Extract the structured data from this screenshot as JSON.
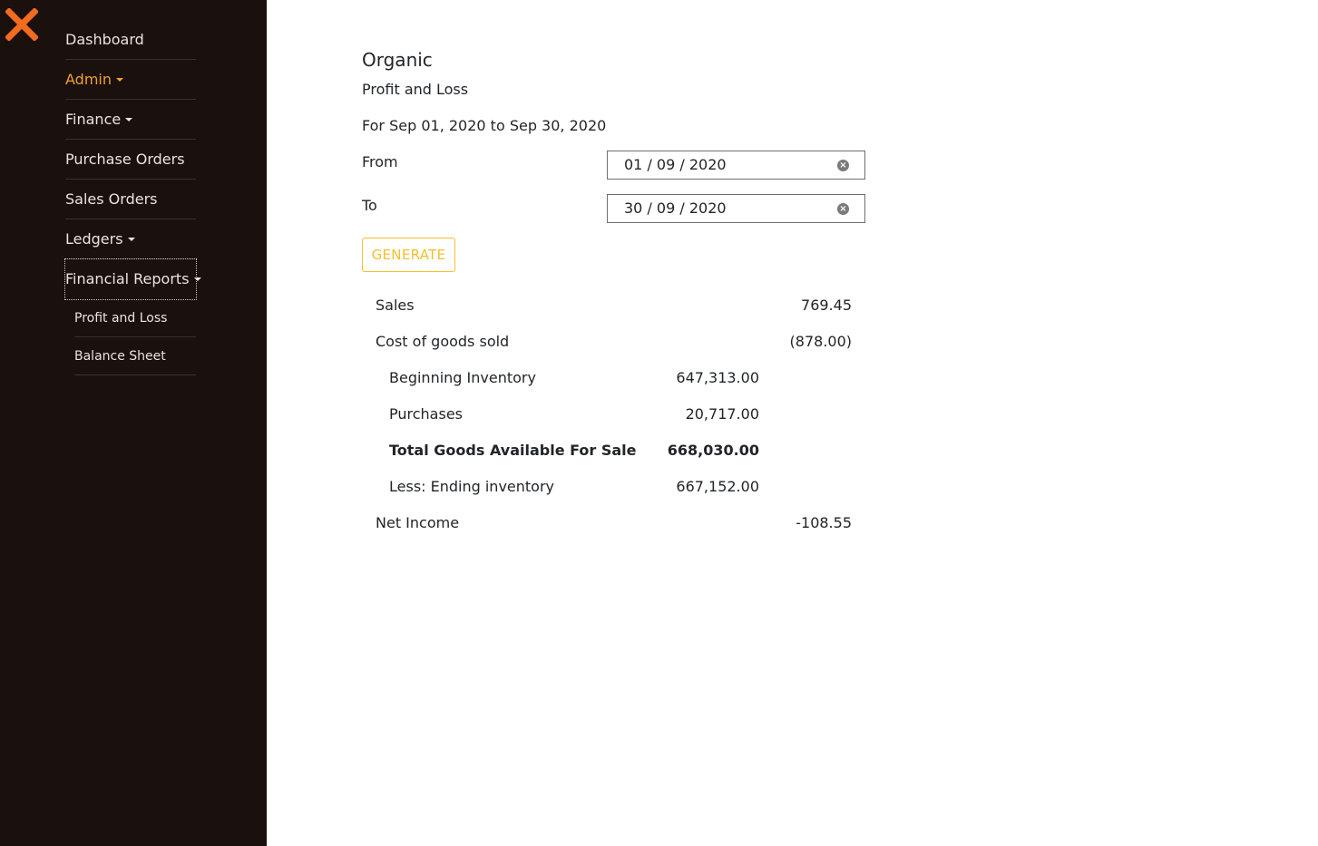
{
  "colors": {
    "sidebar_bg": "#1a100e",
    "accent": "#f0a030",
    "logo": "#f26b1f",
    "button": "#f5bf2a"
  },
  "logo": {
    "icon": "x-logo-icon"
  },
  "sidebar": {
    "items": [
      {
        "label": "Dashboard"
      },
      {
        "label": "Admin"
      },
      {
        "label": "Finance"
      },
      {
        "label": "Purchase Orders"
      },
      {
        "label": "Sales Orders"
      },
      {
        "label": "Ledgers"
      },
      {
        "label": "Financial Reports"
      }
    ],
    "submenu": [
      {
        "label": "Profit and Loss"
      },
      {
        "label": "Balance Sheet"
      }
    ]
  },
  "report": {
    "company": "Organic",
    "title": "Profit and Loss",
    "period": "For Sep 01, 2020 to Sep 30, 2020",
    "from_label": "From",
    "from_value": "01 / 09 / 2020",
    "to_label": "To",
    "to_value": "30 / 09 / 2020",
    "generate_label": "GENERATE"
  },
  "pnl": {
    "sales": {
      "label": "Sales",
      "value": "769.45"
    },
    "cogs": {
      "label": "Cost of goods sold",
      "value": "(878.00)"
    },
    "beginning": {
      "label": "Beginning Inventory",
      "value": "647,313.00"
    },
    "purchases": {
      "label": "Purchases",
      "value": "20,717.00"
    },
    "total": {
      "label": "Total Goods Available For Sale",
      "value": "668,030.00"
    },
    "ending": {
      "label": "Less: Ending inventory",
      "value": "667,152.00"
    },
    "net": {
      "label": "Net Income",
      "value": "-108.55"
    }
  }
}
